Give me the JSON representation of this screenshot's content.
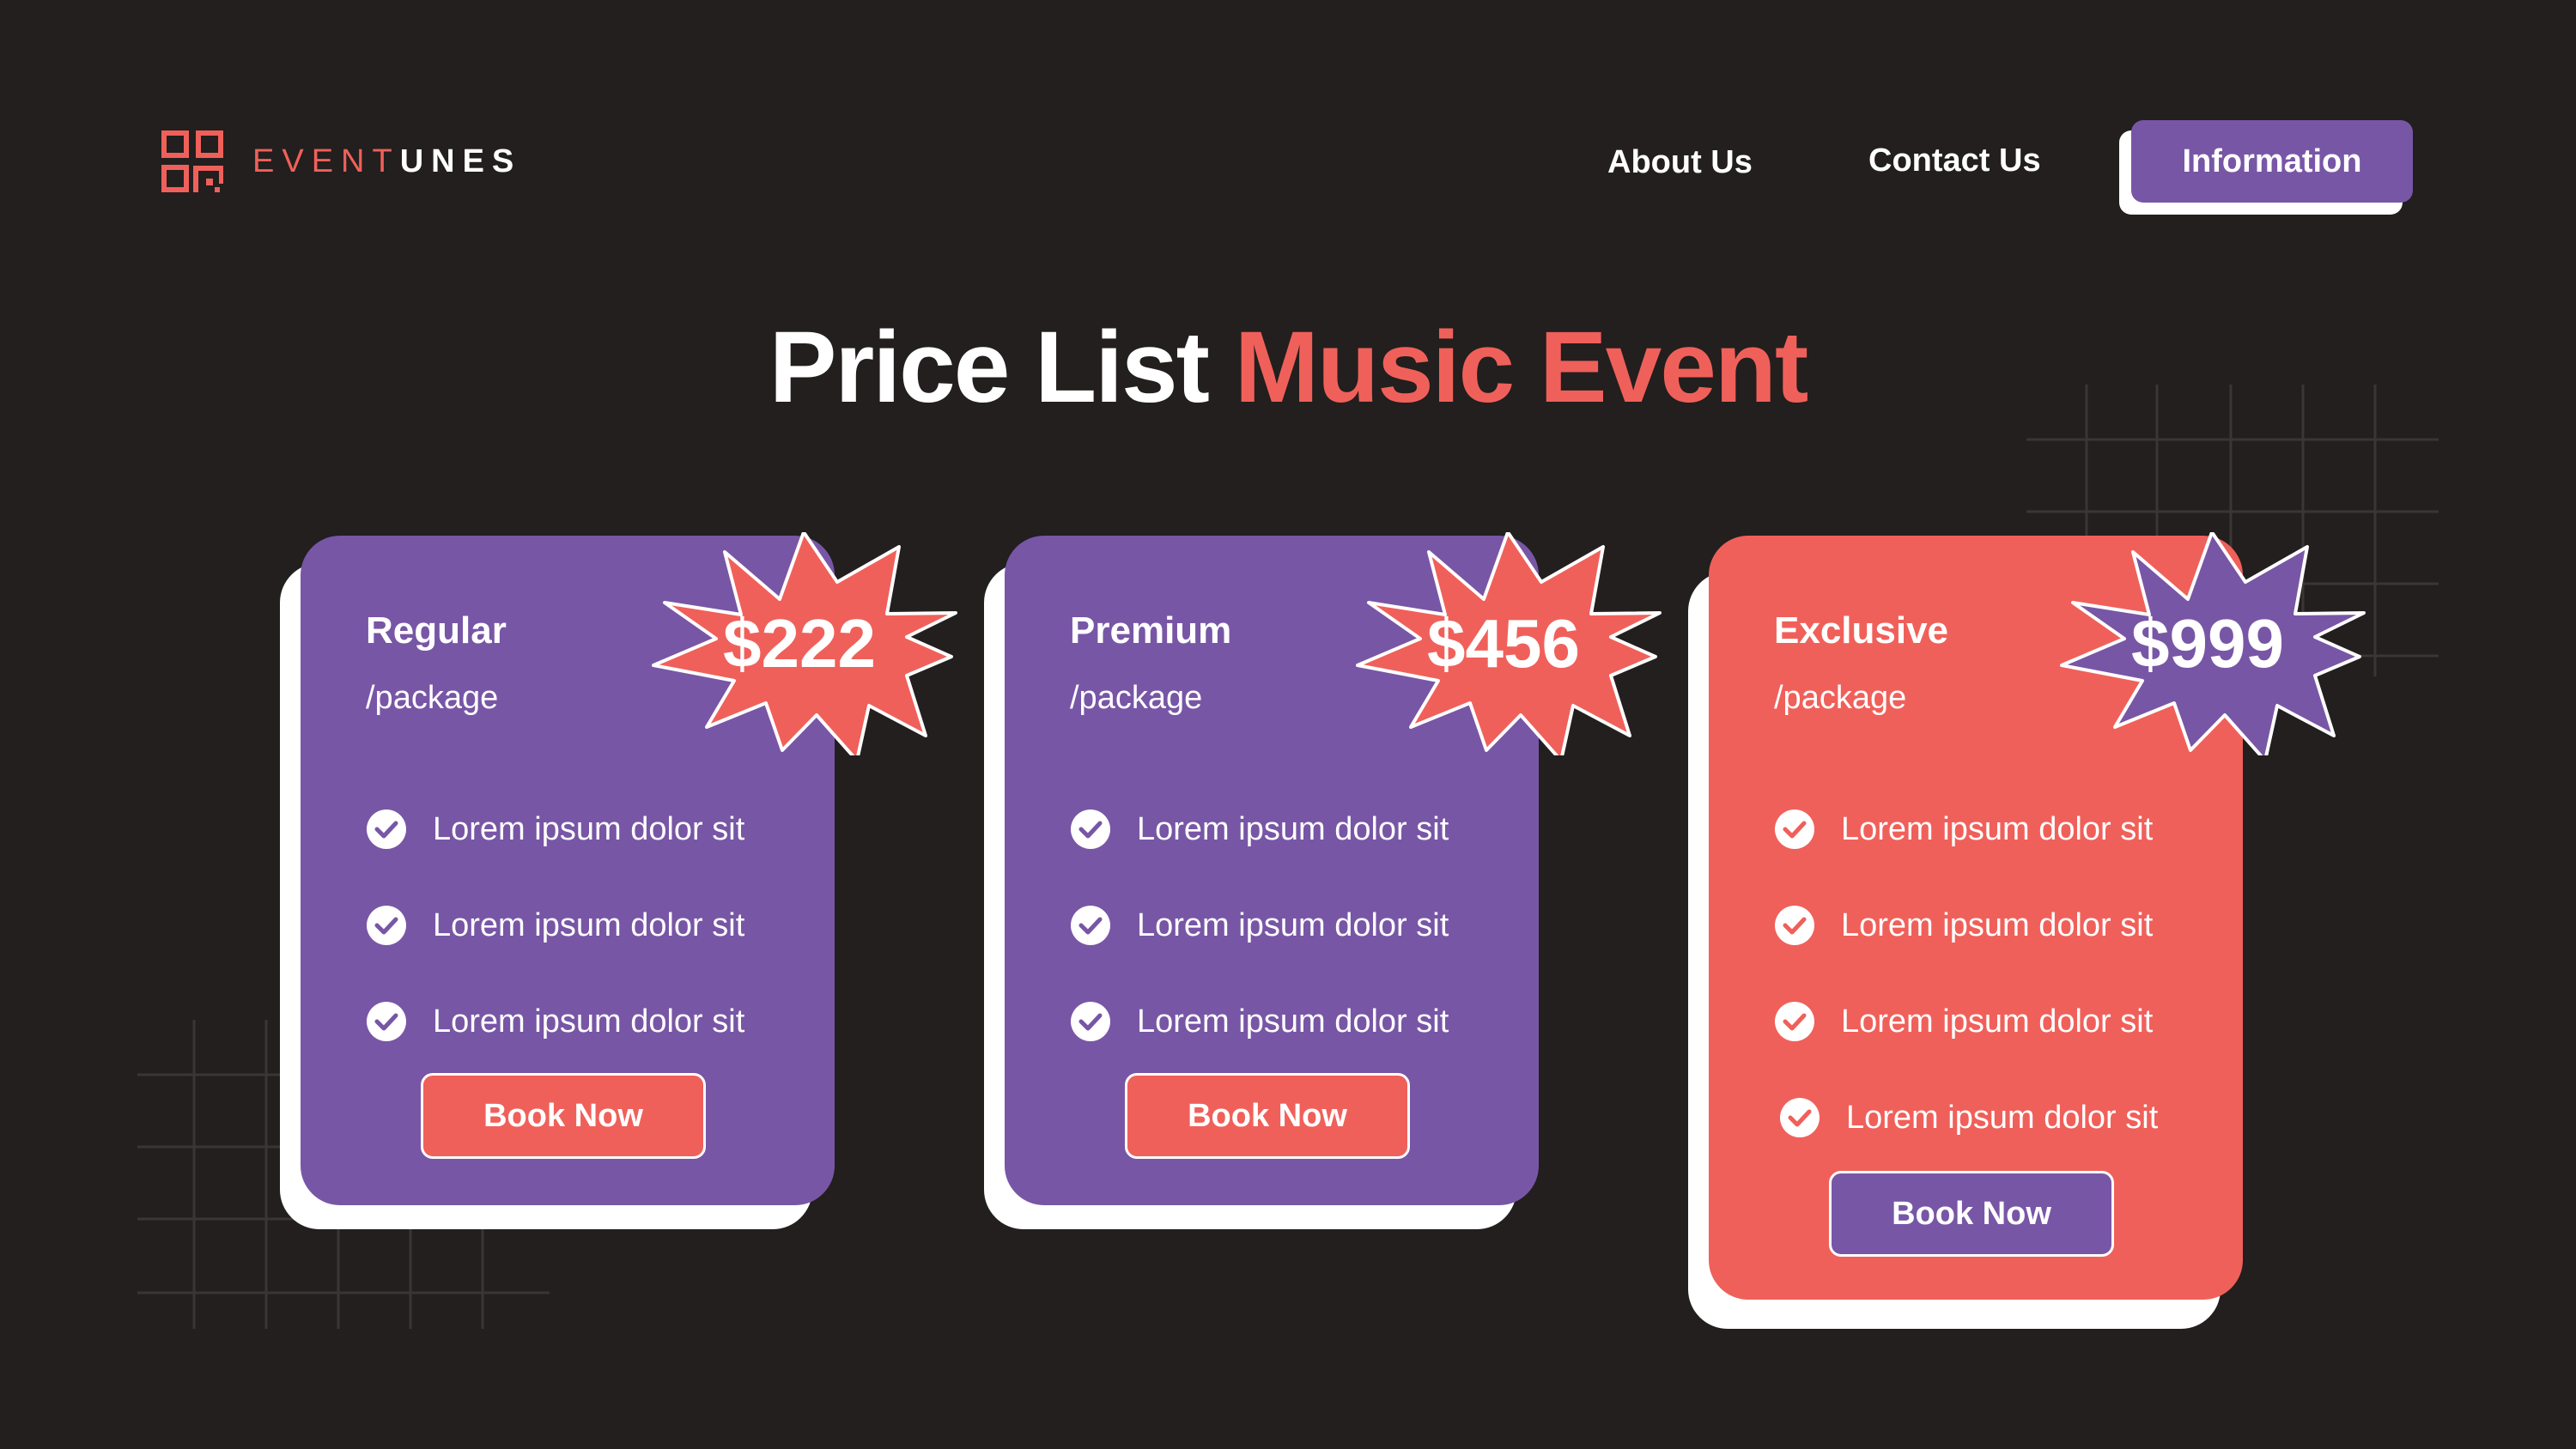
{
  "brand": {
    "name_part1": "EVENT",
    "name_part2": "UNES"
  },
  "nav": {
    "about": "About Us",
    "contact": "Contact Us",
    "information": "Information"
  },
  "title": {
    "part1": "Price List ",
    "part2": "Music Event"
  },
  "colors": {
    "background": "#221f1e",
    "purple": "#7856a6",
    "coral": "#f0605a",
    "white": "#ffffff"
  },
  "cards": [
    {
      "tier": "Regular",
      "per": "/package",
      "price": "$222",
      "features": [
        "Lorem ipsum dolor sit",
        "Lorem ipsum dolor sit",
        "Lorem ipsum dolor sit"
      ],
      "button": "Book Now"
    },
    {
      "tier": "Premium",
      "per": "/package",
      "price": "$456",
      "features": [
        "Lorem ipsum dolor sit",
        "Lorem ipsum dolor sit",
        "Lorem ipsum dolor sit"
      ],
      "button": "Book Now"
    },
    {
      "tier": "Exclusive",
      "per": "/package",
      "price": "$999",
      "features": [
        "Lorem ipsum dolor sit",
        "Lorem ipsum dolor sit",
        "Lorem ipsum dolor sit",
        "Lorem ipsum dolor sit"
      ],
      "button": "Book Now"
    }
  ]
}
